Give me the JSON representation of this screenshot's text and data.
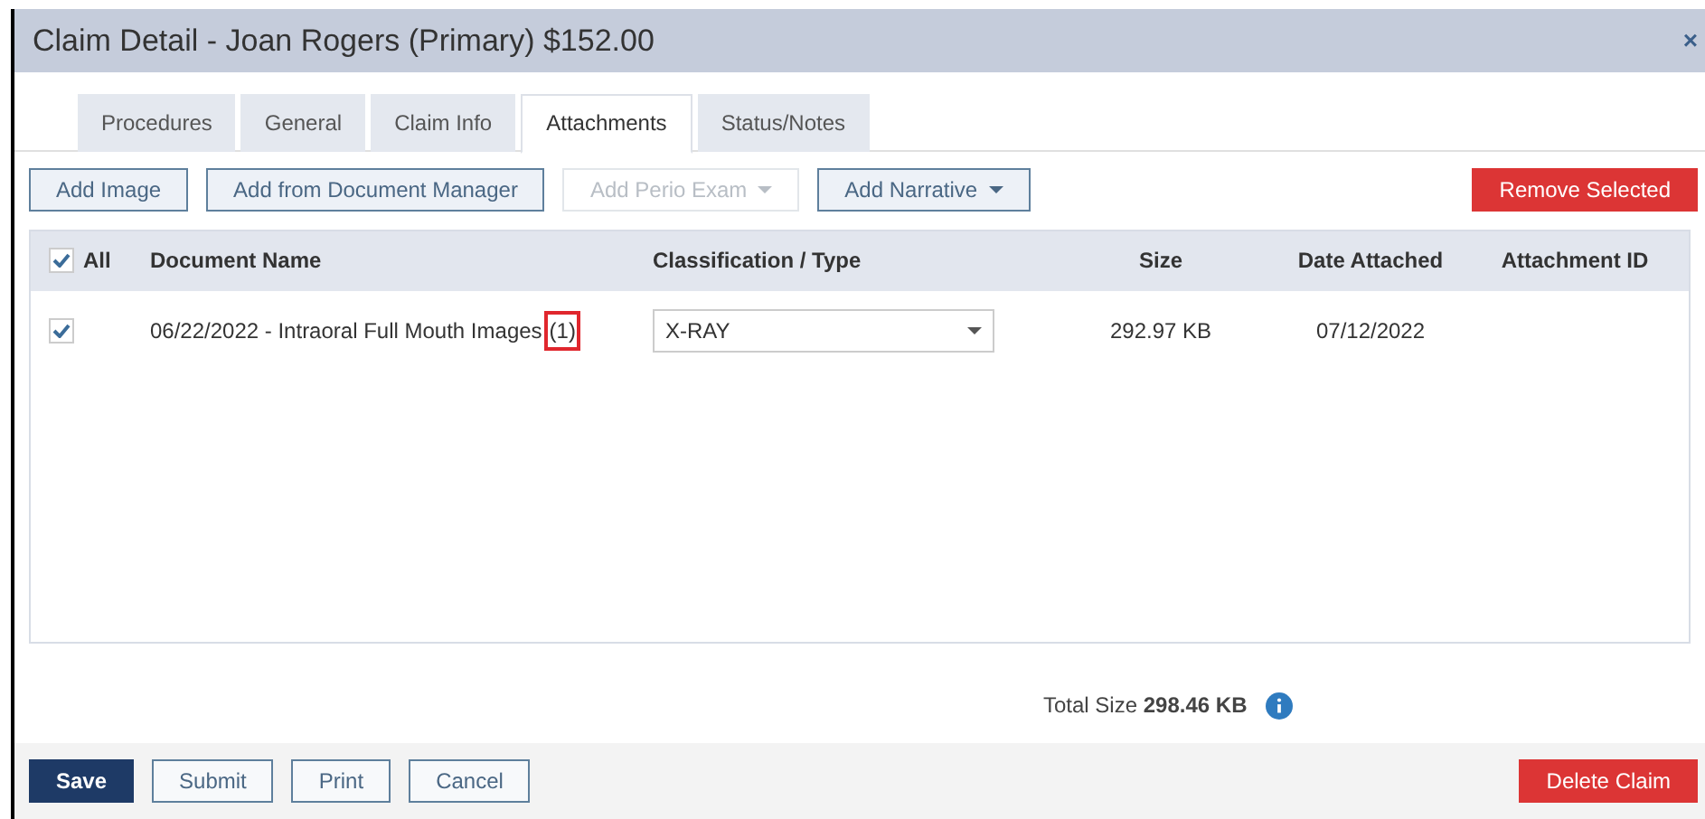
{
  "window": {
    "title": "Claim Detail - Joan Rogers (Primary) $152.00",
    "close": "×"
  },
  "tabs": [
    {
      "label": "Procedures",
      "selected": false
    },
    {
      "label": "General",
      "selected": false
    },
    {
      "label": "Claim Info",
      "selected": false
    },
    {
      "label": "Attachments",
      "selected": true
    },
    {
      "label": "Status/Notes",
      "selected": false
    }
  ],
  "toolbar": [
    {
      "label": "Add Image",
      "kind": "outline",
      "disabled": false,
      "dropdown": false
    },
    {
      "label": "Add from Document Manager",
      "kind": "outline",
      "disabled": false,
      "dropdown": false
    },
    {
      "label": "Add Perio Exam",
      "kind": "outline",
      "disabled": true,
      "dropdown": true
    },
    {
      "label": "Add Narrative",
      "kind": "outline",
      "disabled": false,
      "dropdown": true
    },
    {
      "label": "Remove Selected",
      "kind": "danger",
      "disabled": false,
      "dropdown": false
    }
  ],
  "table": {
    "select_all": {
      "label": "All",
      "checked": true
    },
    "columns": [
      "Document Name",
      "Classification / Type",
      "Size",
      "Date Attached",
      "Attachment ID"
    ],
    "rows": [
      {
        "checked": true,
        "document_name": "06/22/2022 - Intraoral Full Mouth Images",
        "count": "(1)",
        "count_highlighted": true,
        "classification": "X-RAY",
        "size": "292.97 KB",
        "date_attached": "07/12/2022"
      }
    ]
  },
  "total": {
    "label": "Total Size",
    "value": "298.46 KB"
  },
  "footer": [
    {
      "label": "Save",
      "kind": "primary"
    },
    {
      "label": "Submit",
      "kind": "outline"
    },
    {
      "label": "Print",
      "kind": "outline"
    },
    {
      "label": "Cancel",
      "kind": "outline"
    },
    {
      "label": "Delete Claim",
      "kind": "danger"
    }
  ]
}
